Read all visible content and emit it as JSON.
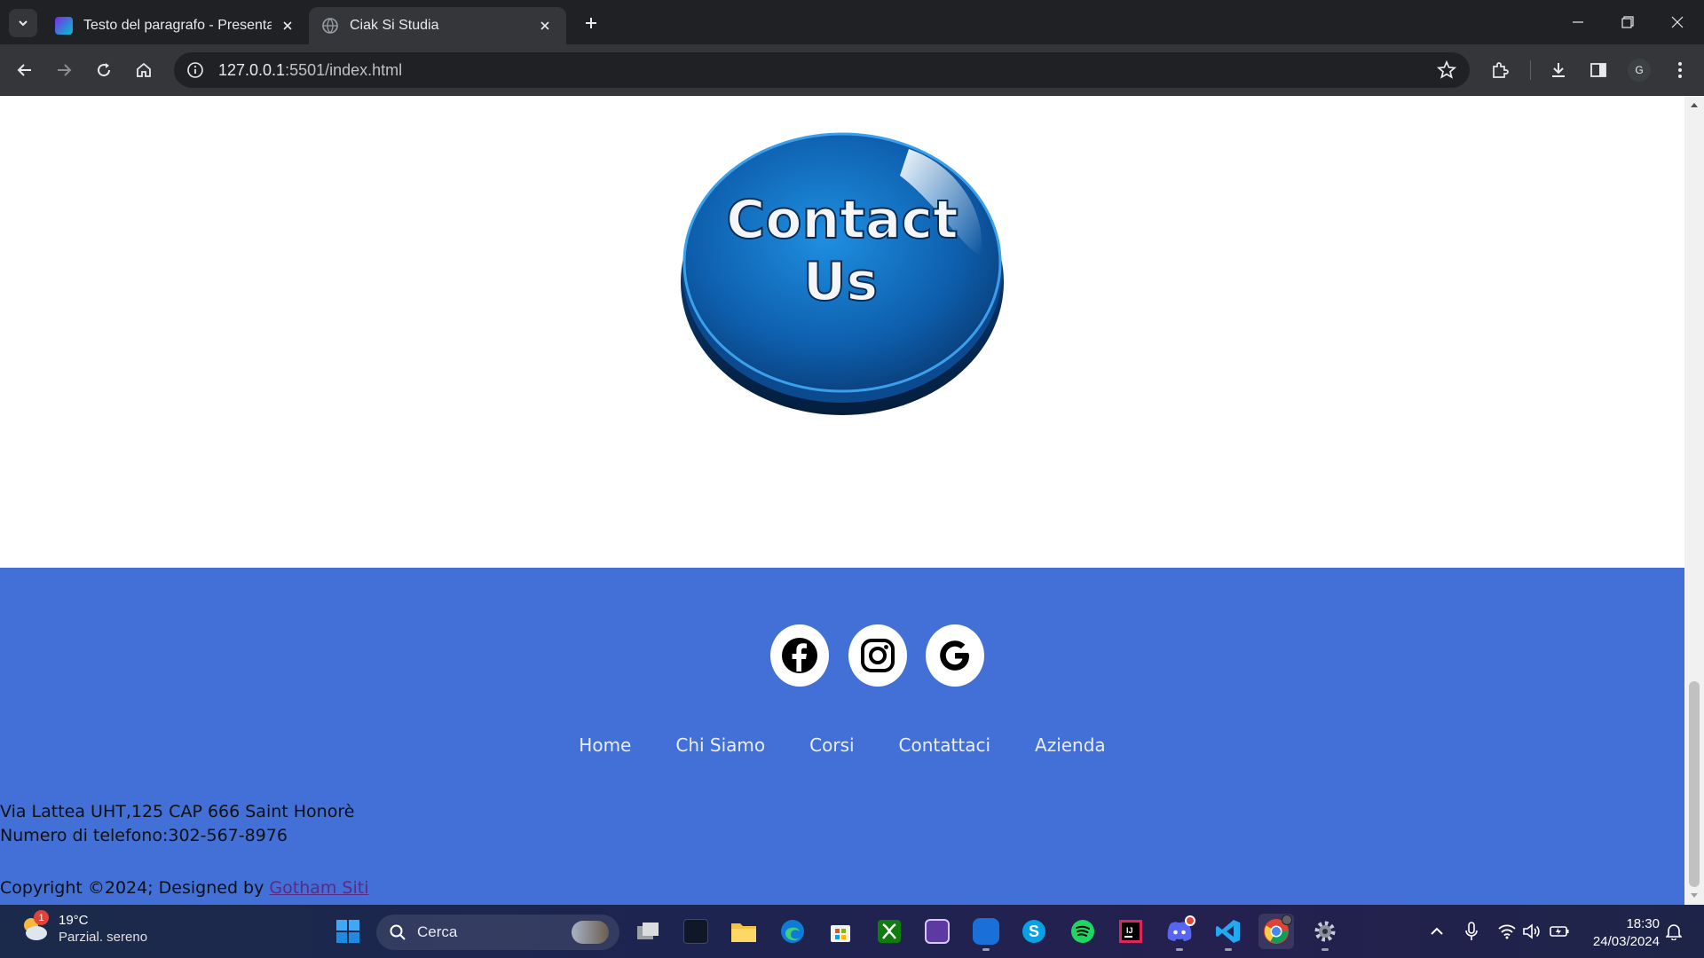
{
  "browser": {
    "tabs": [
      {
        "title": "Testo del paragrafo - Presentazi",
        "active": false
      },
      {
        "title": "Ciak Si Studia",
        "active": true
      }
    ],
    "url_host": "127.0.0.1",
    "url_rest": ":5501/index.html",
    "profile_initial": "G"
  },
  "page": {
    "contact_image_text": [
      "Contact",
      "Us"
    ],
    "footer": {
      "social": [
        "facebook",
        "instagram",
        "google"
      ],
      "nav": [
        "Home",
        "Chi Siamo",
        "Corsi",
        "Contattaci",
        "Azienda"
      ],
      "address_line1": "Via Lattea UHT,125 CAP 666 Saint Honorè",
      "address_line2": "Numero di telefono:302-567-8976",
      "copyright_prefix": "Copyright ©2024; Designed by ",
      "copyright_link": "Gotham Siti"
    },
    "colors": {
      "footer_bg": "#4270d6",
      "contact_button": "#1a66b8"
    }
  },
  "taskbar": {
    "weather_temp": "19°C",
    "weather_desc": "Parzial. sereno",
    "weather_badge": "1",
    "search_placeholder": "Cerca",
    "time": "18:30",
    "date": "24/03/2024"
  }
}
